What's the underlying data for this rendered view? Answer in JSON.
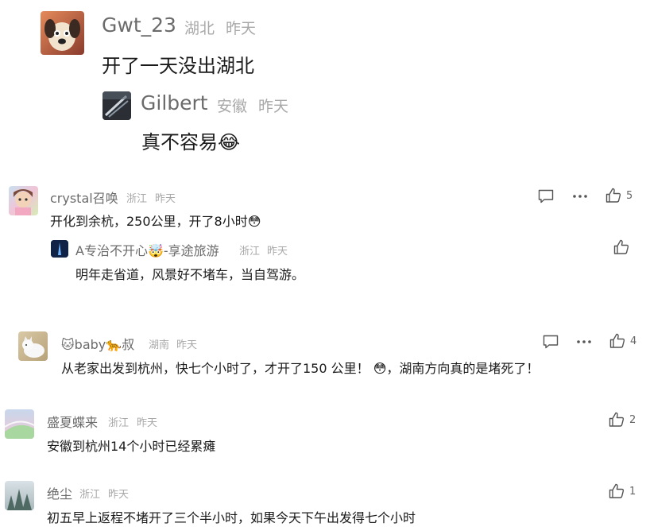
{
  "comments": [
    {
      "user": "Gwt_23",
      "location": "湖北",
      "time": "昨天",
      "text": "开了一天没出湖北",
      "reply": {
        "user": "Gilbert",
        "location": "安徽",
        "time": "昨天",
        "text": "真不容易😂"
      }
    },
    {
      "user": "crystal召唤",
      "location": "浙江",
      "time": "昨天",
      "text": "开化到余杭，250公里，开了8小时😳",
      "likes": "5",
      "reply": {
        "user": "A专治不开心🤯-享途旅游",
        "location": "浙江",
        "time": "昨天",
        "text": "明年走省道，风景好不堵车，当自驾游。"
      }
    },
    {
      "user": "🐱baby🐆叔",
      "location": "湖南",
      "time": "昨天",
      "text": "从老家出发到杭州，快七个小时了，才开了150 公里！ 😳，湖南方向真的是堵死了！",
      "likes": "4"
    },
    {
      "user": "盛夏蝶来",
      "location": "浙江",
      "time": "昨天",
      "text": "安徽到杭州14个小时已经累瘫",
      "likes": "2"
    },
    {
      "user": "绝尘",
      "location": "浙江",
      "time": "昨天",
      "text": "初五早上返程不堵开了三个半小时，如果今天下午出发得七个小时",
      "likes": "1"
    }
  ],
  "colors": {
    "name": "#6b6b6b",
    "meta": "#a8a8a8",
    "text": "#1a1a1a",
    "icon": "#555555"
  }
}
